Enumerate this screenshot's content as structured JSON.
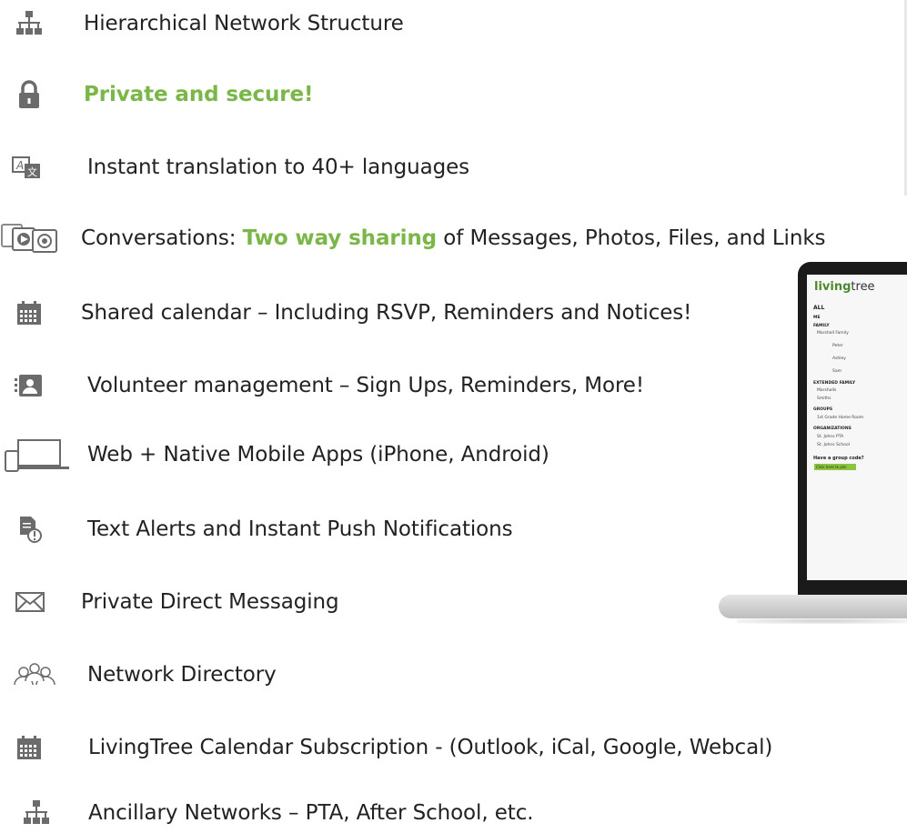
{
  "features": [
    {
      "icon": "hierarchy-icon",
      "text": "Hierarchical Network Structure"
    },
    {
      "icon": "lock-icon",
      "text": "Private and secure!"
    },
    {
      "icon": "translate-icon",
      "text": "Instant translation to 40+ languages"
    },
    {
      "icon": "media-sharing-icon",
      "prefix": "Conversations: ",
      "highlight": "Two way sharing",
      "suffix": " of Messages, Photos, Files, and Links"
    },
    {
      "icon": "calendar-icon",
      "text": "Shared calendar – Including RSVP, Reminders and Notices!"
    },
    {
      "icon": "contact-card-icon",
      "text": "Volunteer management – Sign Ups, Reminders, More!"
    },
    {
      "icon": "devices-icon",
      "text": "Web + Native Mobile Apps (iPhone, Android)"
    },
    {
      "icon": "alert-document-icon",
      "text": "Text Alerts and Instant Push Notifications"
    },
    {
      "icon": "envelope-icon",
      "text": "Private Direct Messaging"
    },
    {
      "icon": "people-group-icon",
      "text": "Network Directory"
    },
    {
      "icon": "calendar-icon",
      "text": "LivingTree Calendar Subscription -  (Outlook, iCal, Google, Webcal)"
    },
    {
      "icon": "hierarchy-icon",
      "text": "Ancillary Networks – PTA, After School, etc."
    }
  ],
  "colors": {
    "highlight": "#7ab648",
    "icon": "#6b6b6b"
  },
  "laptop": {
    "logo_bold": "living",
    "logo_rest": "tree",
    "sidebar": {
      "all": "ALL",
      "me": "ME",
      "family": "FAMILY",
      "marshall_family": "Marshall Family",
      "peter": "Peter",
      "ashley": "Ashley",
      "sam": "Sam",
      "extended_family": "EXTENDED FAMILY",
      "marshalls": "Marshalls",
      "smiths": "Smiths",
      "groups": "GROUPS",
      "home_room": "1st Grade Home Room",
      "organizations": "ORGANIZATIONS",
      "st_johns_pta": "St. Johns PTA",
      "st_johns_school": "St. Johns School",
      "group_code": "Have a group code?",
      "join_button": "Click here to join"
    }
  }
}
